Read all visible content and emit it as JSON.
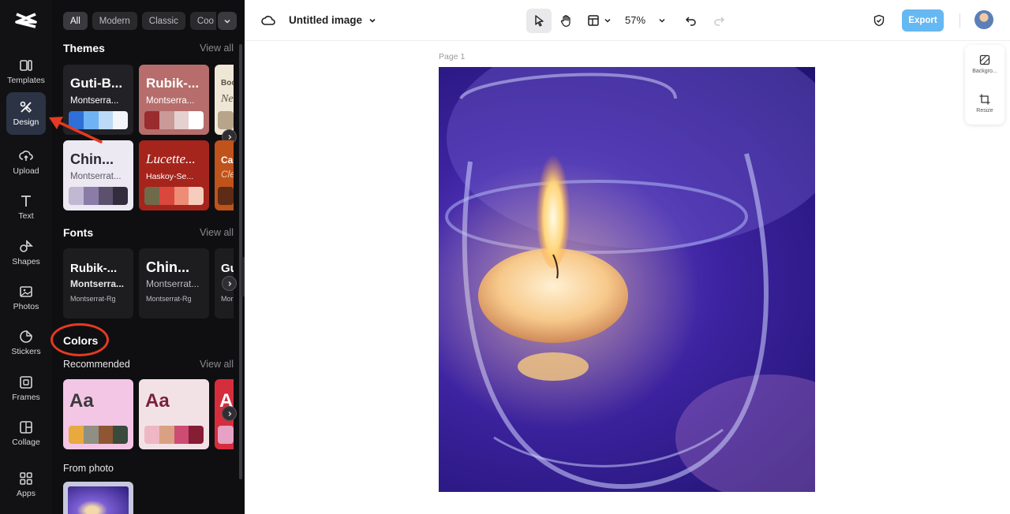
{
  "rail": {
    "items": [
      {
        "label": "Templates",
        "icon": "templates-icon"
      },
      {
        "label": "Design",
        "icon": "design-icon",
        "active": true
      },
      {
        "label": "Upload",
        "icon": "upload-icon"
      },
      {
        "label": "Text",
        "icon": "text-icon"
      },
      {
        "label": "Shapes",
        "icon": "shapes-icon"
      },
      {
        "label": "Photos",
        "icon": "photos-icon"
      },
      {
        "label": "Stickers",
        "icon": "stickers-icon"
      },
      {
        "label": "Frames",
        "icon": "frames-icon"
      },
      {
        "label": "Collage",
        "icon": "collage-icon"
      },
      {
        "label": "Apps",
        "icon": "apps-icon"
      }
    ]
  },
  "panel": {
    "chips": [
      "All",
      "Modern",
      "Classic",
      "Coo"
    ],
    "themes": {
      "title": "Themes",
      "view_all": "View all",
      "cards": [
        {
          "name": "Guti-B...",
          "font": "Montserra...",
          "bg": "#222226",
          "fg": "#ffffff",
          "swatches": [
            "#2f6fd8",
            "#6fb3f4",
            "#bcd9f7",
            "#f3f5f8"
          ]
        },
        {
          "name": "Rubik-...",
          "font": "Montserra...",
          "bg": "#b66d6b",
          "fg": "#ffffff",
          "swatches": [
            "#9a2b2e",
            "#c99a98",
            "#e4d0cf",
            "#ffffff"
          ]
        },
        {
          "name": "Boo",
          "font": "Ne",
          "bg": "#efe7d6",
          "fg": "#5b5142",
          "swatches": [
            "#b7a48a",
            "#d8cbb4"
          ]
        },
        {
          "name": "Chin...",
          "font": "Montserrat...",
          "bg": "#ece9f2",
          "fg": "#2b2833",
          "swatches": [
            "#c1b8d3",
            "#8a7ba7",
            "#5c506f",
            "#332c3d"
          ]
        },
        {
          "name": "Lucette...",
          "font": "Haskoy-Se...",
          "bg": "#a5241c",
          "fg": "#ffffff",
          "swatches": [
            "#6f6a4a",
            "#d9473d",
            "#ee8c76",
            "#f6cdbd"
          ]
        },
        {
          "name": "Ca",
          "font": "Cle",
          "bg": "#c0521c",
          "fg": "#ffffff",
          "swatches": [
            "#5d2b16"
          ]
        }
      ]
    },
    "fonts": {
      "title": "Fonts",
      "view_all": "View all",
      "cards": [
        {
          "name": "Rubik-...",
          "sub": "Montserra...",
          "caption": "Montserrat-Rg"
        },
        {
          "name": "Chin...",
          "sub": "Montserrat...",
          "caption": "Montserrat-Rg"
        },
        {
          "name": "Gu",
          "sub": "",
          "caption": "Mor"
        }
      ]
    },
    "colors": {
      "title": "Colors",
      "recommended": "Recommended",
      "view_all": "View all",
      "cards": [
        {
          "sample": "Aa",
          "bg": "#f3c6e6",
          "fg": "#3b3b3b",
          "swatches": [
            "#e8a93e",
            "#8f8f84",
            "#8e5632",
            "#3a4a3d"
          ]
        },
        {
          "sample": "Aa",
          "bg": "#f2e2e6",
          "fg": "#7b1f3c",
          "swatches": [
            "#efb7c3",
            "#d9a083",
            "#cc4c73",
            "#851d35"
          ]
        },
        {
          "sample": "A",
          "bg": "#d52d3b",
          "fg": "#ffffff",
          "swatches": [
            "#e6a2c4"
          ]
        }
      ],
      "from_photo": "From photo"
    }
  },
  "topbar": {
    "title": "Untitled image",
    "zoom": "57%",
    "export_label": "Export"
  },
  "canvas": {
    "page_label": "Page 1"
  },
  "minitools": {
    "background_label": "Backgro...",
    "resize_label": "Resize"
  },
  "colors": {
    "rail_bg": "#121214",
    "panel_bg": "#0f0f11",
    "accent": "#66b8f2",
    "annotation": "#e43a22"
  }
}
